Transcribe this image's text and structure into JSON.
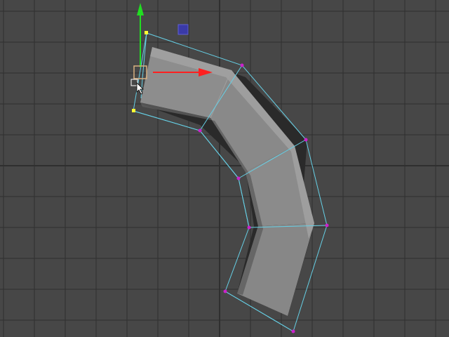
{
  "viewport": {
    "view": "perspective",
    "background_color": "#474747",
    "grid_color": "#2f2f2f",
    "grid_on": true
  },
  "mesh": {
    "object": "bent-tube",
    "shading_color": "#8a8a8a",
    "highlight_color": "#a8a8a8",
    "shadow_color": "#5e5e5e",
    "lattice_color": "#66d0e6",
    "lattice_point_color": "#cc22cc",
    "selected_point_color": "#ffff33"
  },
  "gizmo": {
    "tool": "move-tool",
    "x_axis_color": "#ff2020",
    "y_axis_color": "#22dd22",
    "plane_handle_color": "#3a3aa8",
    "center_handle_color": "#d8b080"
  },
  "cursor": {
    "icon": "move-cursor-icon"
  }
}
